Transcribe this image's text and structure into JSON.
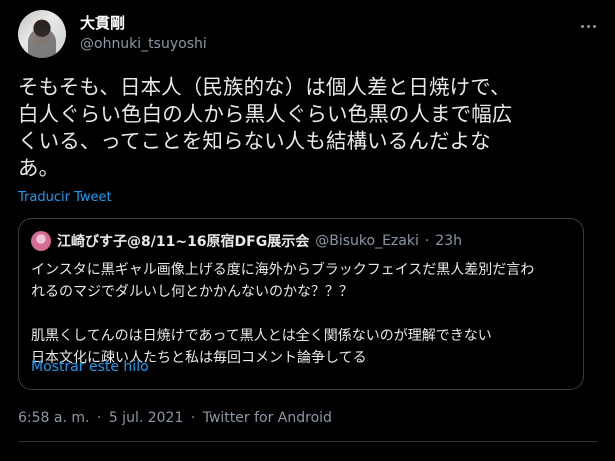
{
  "author": {
    "display_name": "大貫剛",
    "handle": "@ohnuki_tsuyoshi"
  },
  "tweet": {
    "text": "そもそも、日本人（民族的な）は個人差と日焼けで、\n白人ぐらい色白の人から黒人ぐらい色黒の人まで幅広\nくいる、ってことを知らない人も結構いるんだよな\nあ。",
    "translate_label": "Traducir Tweet"
  },
  "quoted_tweet": {
    "display_name": "江崎びす子@8/11~16原宿DFG展示会",
    "handle": "@Bisuko_Ezaki",
    "separator": "·",
    "time": "23h",
    "text": "インスタに黒ギャル画像上げる度に海外からブラックフェイスだ黒人差別だ言わ\nれるのマジでダルいし何とかかんないのかな？？？\n\n肌黒くしてんのは日焼けであって黒人とは全く関係ないのが理解できない\n日本文化に疎い人たちと私は毎回コメント論争してる",
    "show_thread_label": "Mostrar este hilo"
  },
  "meta": {
    "time": "6:58 a. m.",
    "separator_1": "·",
    "date": "5 jul. 2021",
    "separator_2": "·",
    "source": "Twitter for Android"
  },
  "icons": {
    "more": "more-horizontal-icon",
    "avatar": "user-avatar",
    "quote_avatar": "quoted-user-avatar"
  },
  "colors": {
    "background": "#000000",
    "text_primary": "#e7e9ea",
    "text_secondary": "#8b98a5",
    "link": "#1d9bf0",
    "border": "#3a3d40"
  }
}
